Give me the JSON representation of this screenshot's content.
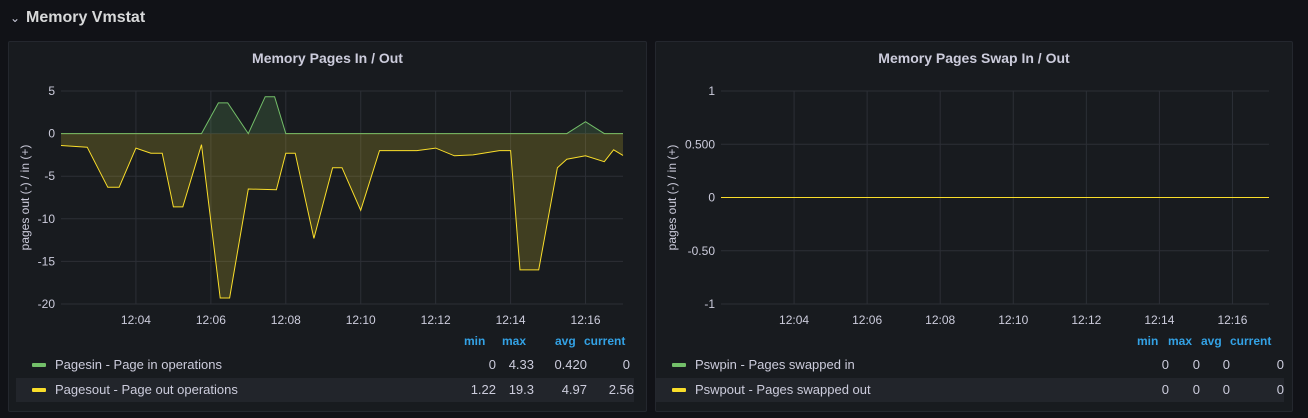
{
  "row": {
    "title": "Memory Vmstat",
    "chevron_icon": "chevron-down-icon"
  },
  "colors": {
    "green": "#73bf69",
    "yellow": "#fade2a",
    "grid": "#2c2f36",
    "legend_header": "#33a2e5"
  },
  "panels": [
    {
      "title": "Memory Pages In / Out",
      "legend_headers": [
        "min",
        "max",
        "avg",
        "current"
      ],
      "legend": [
        {
          "name": "Pagesin - Page in operations",
          "color": "#73bf69",
          "min": "0",
          "max": "4.33",
          "avg": "0.420",
          "current": "0"
        },
        {
          "name": "Pagesout - Page out operations",
          "color": "#fade2a",
          "min": "1.22",
          "max": "19.3",
          "avg": "4.97",
          "current": "2.56"
        }
      ]
    },
    {
      "title": "Memory Pages Swap In / Out",
      "legend_headers": [
        "min",
        "max",
        "avg",
        "current"
      ],
      "legend": [
        {
          "name": "Pswpin - Pages swapped in",
          "color": "#73bf69",
          "min": "0",
          "max": "0",
          "avg": "0",
          "current": "0"
        },
        {
          "name": "Pswpout - Pages swapped out",
          "color": "#fade2a",
          "min": "0",
          "max": "0",
          "avg": "0",
          "current": "0"
        }
      ]
    }
  ],
  "chart_data": [
    {
      "type": "area",
      "title": "Memory Pages In / Out",
      "ylabel": "pages out (-) / in (+)",
      "xlabel": "",
      "x_ticks": [
        "12:04",
        "12:06",
        "12:08",
        "12:10",
        "12:12",
        "12:14",
        "12:16"
      ],
      "x_tick_minutes": [
        4,
        6,
        8,
        10,
        12,
        14,
        16
      ],
      "xlim": [
        2.0,
        17.0
      ],
      "y_ticks": [
        "5",
        "0",
        "-5",
        "-10",
        "-15",
        "-20"
      ],
      "y_tick_values": [
        5,
        0,
        -5,
        -10,
        -15,
        -20
      ],
      "ylim": [
        -20,
        5
      ],
      "grid": true,
      "series": [
        {
          "name": "Pagesin - Page in operations",
          "color": "#73bf69",
          "x": [
            2.0,
            5.75,
            6.2,
            6.45,
            7.0,
            7.45,
            7.7,
            8.0,
            15.5,
            16.0,
            16.5,
            17.0
          ],
          "y": [
            0,
            0,
            3.6,
            3.6,
            0,
            4.33,
            4.33,
            0,
            0,
            1.4,
            0,
            0
          ]
        },
        {
          "name": "Pagesout - Page out operations",
          "color": "#fade2a",
          "x": [
            2.0,
            2.7,
            3.25,
            3.55,
            4.0,
            4.4,
            4.7,
            5.0,
            5.25,
            5.75,
            6.25,
            6.5,
            7.0,
            7.75,
            8.0,
            8.25,
            8.75,
            9.25,
            9.5,
            10.0,
            10.5,
            11.0,
            11.5,
            12.0,
            12.5,
            13.0,
            13.7,
            14.0,
            14.25,
            14.75,
            15.25,
            15.5,
            16.0,
            16.5,
            16.75,
            17.0
          ],
          "y": [
            -1.4,
            -1.6,
            -6.3,
            -6.3,
            -1.7,
            -2.3,
            -2.3,
            -8.6,
            -8.6,
            -1.3,
            -19.3,
            -19.3,
            -6.5,
            -6.6,
            -2.3,
            -2.3,
            -12.3,
            -4.0,
            -4.0,
            -9.0,
            -2.0,
            -2.0,
            -2.0,
            -1.7,
            -2.6,
            -2.5,
            -2.0,
            -2.0,
            -16.0,
            -16.0,
            -4.0,
            -3.0,
            -2.6,
            -3.3,
            -1.9,
            -2.56
          ]
        }
      ]
    },
    {
      "type": "line",
      "title": "Memory Pages Swap In / Out",
      "ylabel": "pages out (-) / in (+)",
      "xlabel": "",
      "x_ticks": [
        "12:04",
        "12:06",
        "12:08",
        "12:10",
        "12:12",
        "12:14",
        "12:16"
      ],
      "x_tick_minutes": [
        4,
        6,
        8,
        10,
        12,
        14,
        16
      ],
      "xlim": [
        2.0,
        17.0
      ],
      "y_ticks": [
        "1",
        "0.500",
        "0",
        "-0.50",
        "-1"
      ],
      "y_tick_values": [
        1,
        0.5,
        0,
        -0.5,
        -1
      ],
      "ylim": [
        -1,
        1
      ],
      "grid": true,
      "series": [
        {
          "name": "Pswpin - Pages swapped in",
          "color": "#73bf69",
          "x": [
            2.0,
            17.0
          ],
          "y": [
            0,
            0
          ]
        },
        {
          "name": "Pswpout - Pages swapped out",
          "color": "#fade2a",
          "x": [
            2.0,
            17.0
          ],
          "y": [
            0,
            0
          ]
        }
      ]
    }
  ]
}
